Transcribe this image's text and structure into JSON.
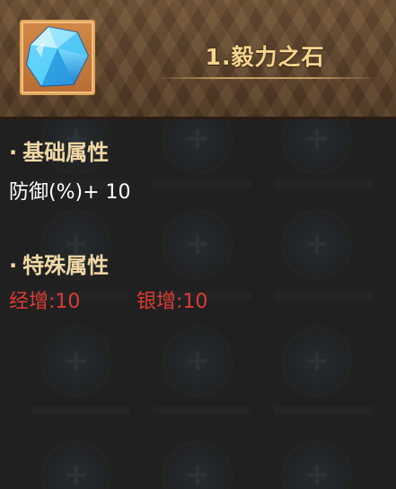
{
  "item": {
    "name": "1.毅力之石",
    "icon": "blue-gem-icon"
  },
  "sections": {
    "basic": {
      "bullet": "·",
      "title": "基础属性",
      "stat": "防御(%)+ 10"
    },
    "special": {
      "bullet": "·",
      "title": "特殊属性",
      "stat_exp": "经增:10",
      "stat_silver": "银增:10"
    }
  },
  "colors": {
    "title": "#f5d58f",
    "section_title": "#f1d9a6",
    "basic_stat": "#ffffff",
    "special_stat": "#dc3b34",
    "header_bg": "#5a412b"
  }
}
